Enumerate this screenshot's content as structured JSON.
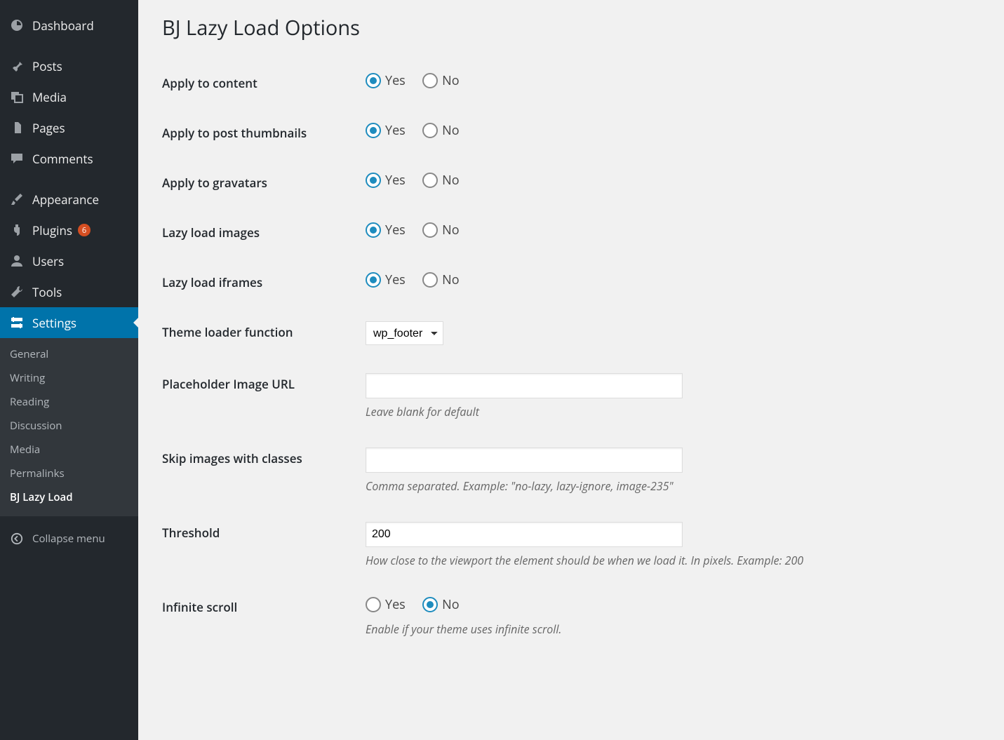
{
  "sidebar": {
    "items": [
      {
        "id": "dashboard",
        "label": "Dashboard",
        "icon": "dashboard-icon"
      },
      {
        "id": "posts",
        "label": "Posts",
        "icon": "pin-icon",
        "sep": true
      },
      {
        "id": "media",
        "label": "Media",
        "icon": "media-icon"
      },
      {
        "id": "pages",
        "label": "Pages",
        "icon": "page-icon"
      },
      {
        "id": "comments",
        "label": "Comments",
        "icon": "comment-icon"
      },
      {
        "id": "appearance",
        "label": "Appearance",
        "icon": "brush-icon",
        "sep": true
      },
      {
        "id": "plugins",
        "label": "Plugins",
        "icon": "plug-icon",
        "badge": "6"
      },
      {
        "id": "users",
        "label": "Users",
        "icon": "user-icon"
      },
      {
        "id": "tools",
        "label": "Tools",
        "icon": "wrench-icon"
      },
      {
        "id": "settings",
        "label": "Settings",
        "icon": "sliders-icon",
        "active": true
      }
    ],
    "submenu": [
      {
        "label": "General"
      },
      {
        "label": "Writing"
      },
      {
        "label": "Reading"
      },
      {
        "label": "Discussion"
      },
      {
        "label": "Media"
      },
      {
        "label": "Permalinks"
      },
      {
        "label": "BJ Lazy Load",
        "current": true
      }
    ],
    "collapse_label": "Collapse menu"
  },
  "page": {
    "title": "BJ Lazy Load Options"
  },
  "opts": {
    "yes": "Yes",
    "no": "No"
  },
  "fields": {
    "apply_content": {
      "label": "Apply to content",
      "value": "yes"
    },
    "apply_thumbs": {
      "label": "Apply to post thumbnails",
      "value": "yes"
    },
    "apply_gravatars": {
      "label": "Apply to gravatars",
      "value": "yes"
    },
    "lazy_images": {
      "label": "Lazy load images",
      "value": "yes"
    },
    "lazy_iframes": {
      "label": "Lazy load iframes",
      "value": "yes"
    },
    "theme_loader": {
      "label": "Theme loader function",
      "value": "wp_footer"
    },
    "placeholder_url": {
      "label": "Placeholder Image URL",
      "value": "",
      "desc": "Leave blank for default"
    },
    "skip_classes": {
      "label": "Skip images with classes",
      "value": "",
      "desc": "Comma separated. Example: \"no-lazy, lazy-ignore, image-235\""
    },
    "threshold": {
      "label": "Threshold",
      "value": "200",
      "desc": "How close to the viewport the element should be when we load it. In pixels. Example: 200"
    },
    "infinite_scroll": {
      "label": "Infinite scroll",
      "value": "no",
      "desc": "Enable if your theme uses infinite scroll."
    }
  }
}
